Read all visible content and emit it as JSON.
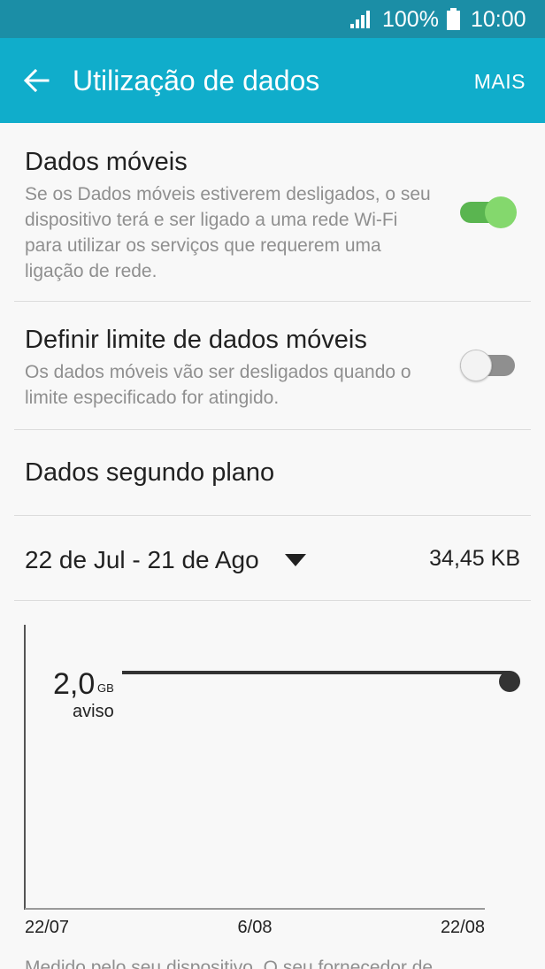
{
  "status_bar": {
    "battery_percent": "100%",
    "time": "10:00"
  },
  "app_bar": {
    "title": "Utilização de dados",
    "more_label": "MAIS"
  },
  "settings": [
    {
      "title": "Dados móveis",
      "description": "Se os Dados móveis estiverem desligados, o seu dispositivo terá e ser ligado a uma rede Wi-Fi para utilizar os serviços que requerem uma ligação de rede.",
      "toggle": "on"
    },
    {
      "title": "Definir limite de dados móveis",
      "description": "Os dados móveis vão ser desligados quando o limite especificado for atingido.",
      "toggle": "off"
    },
    {
      "title": "Dados segundo plano"
    }
  ],
  "cycle": {
    "range_label": "22 de Jul - 21 de Ago",
    "usage": "34,45 KB"
  },
  "chart_data": {
    "type": "line",
    "warning_value": "2,0",
    "warning_unit": "GB",
    "warning_label": "aviso",
    "warning_gb": 2.0,
    "x_ticks": [
      "22/07",
      "6/08",
      "22/08"
    ]
  },
  "footer_note": "Medido pelo seu dispositivo. O seu fornecedor de"
}
